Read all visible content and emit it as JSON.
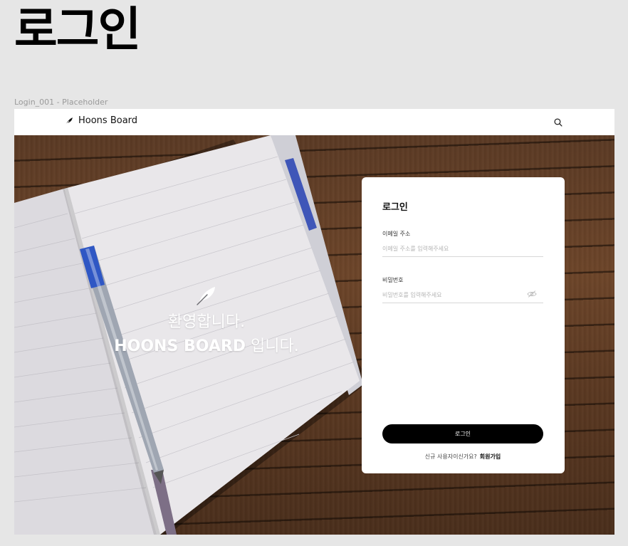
{
  "page": {
    "heading": "로그인",
    "frame_label": "Login_001 - Placeholder"
  },
  "header": {
    "brand_name": "Hoons Board",
    "logo_icon": "feather-icon",
    "search_icon": "search-icon"
  },
  "hero": {
    "welcome_icon": "feather-icon",
    "line1": "환영합니다.",
    "line2_brand": "HOONS BOARD",
    "line2_suffix": " 입니다."
  },
  "login": {
    "title": "로그인",
    "email_label": "이메일 주소",
    "email_placeholder": "이메일 주소를 입력해주세요",
    "email_value": "",
    "password_label": "비밀번호",
    "password_placeholder": "비밀번호를 입력해주세요",
    "password_value": "",
    "password_toggle_icon": "eye-off-icon",
    "submit_label": "로그인",
    "signup_prompt": "신규 사용자이신가요?",
    "signup_link": "회원가입"
  },
  "colors": {
    "page_background": "#e6e6e6",
    "button": "#000000",
    "wood": "#5b3a24"
  }
}
